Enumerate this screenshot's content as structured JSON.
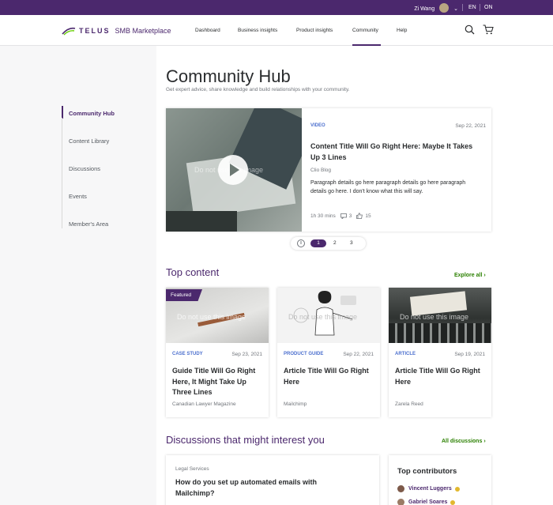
{
  "topbar": {
    "user_name": "Zi Wang",
    "language": "EN",
    "province": "ON"
  },
  "header": {
    "brand": "TELUS",
    "brand_sub": "SMB Marketplace",
    "nav": [
      "Dashboard",
      "Business insights",
      "Product insights",
      "Community",
      "Help"
    ],
    "active_nav": "Community"
  },
  "sidebar": {
    "items": [
      "Community Hub",
      "Content Library",
      "Discussions",
      "Events",
      "Member's Area"
    ],
    "active": "Community Hub"
  },
  "page": {
    "title": "Community Hub",
    "subtitle": "Get expert advice, share knowledge and build relationships with your community."
  },
  "hero": {
    "type": "VIDEO",
    "date": "Sep 22, 2021",
    "title": "Content Title Will Go Right Here: Maybe It Takes Up 3 Lines",
    "source": "Clio Blog",
    "paragraph": "Paragraph details go here paragraph details go here paragraph details go here. I don't know what this will say.",
    "duration": "1h 30 mins",
    "comments": "3",
    "likes": "15",
    "watermark": "Do not use this image"
  },
  "pager": {
    "pages": [
      "1",
      "2",
      "3"
    ],
    "active": "1"
  },
  "top_content": {
    "title": "Top content",
    "link": "Explore all",
    "cards": [
      {
        "badge": "Featured",
        "type": "CASE STUDY",
        "date": "Sep 23, 2021",
        "title": "Guide Title Will Go Right Here, It Might Take Up Three Lines",
        "source": "Canadian Lawyer Magazine",
        "watermark": "Do not use this image"
      },
      {
        "badge": "",
        "type": "PRODUCT GUIDE",
        "date": "Sep 22, 2021",
        "title": "Article Title Will Go Right Here",
        "source": "Mailchimp",
        "watermark": "Do not use this image"
      },
      {
        "badge": "",
        "type": "ARTICLE",
        "date": "Sep 19, 2021",
        "title": "Article Title Will Go Right Here",
        "source": "Zarela Reed",
        "watermark": "Do not use this image"
      }
    ]
  },
  "discussions": {
    "title": "Discussions that might interest you",
    "link": "All discussions",
    "item": {
      "category": "Legal Services",
      "question": "How do you set up automated emails with Mailchimp?"
    }
  },
  "contributors": {
    "title": "Top contributors",
    "people": [
      "Vincent Luggers",
      "Gabriel Soares"
    ]
  },
  "colors": {
    "brand": "#4b286d",
    "accent_green": "#2b8000",
    "tag_blue": "#4b6fce"
  }
}
